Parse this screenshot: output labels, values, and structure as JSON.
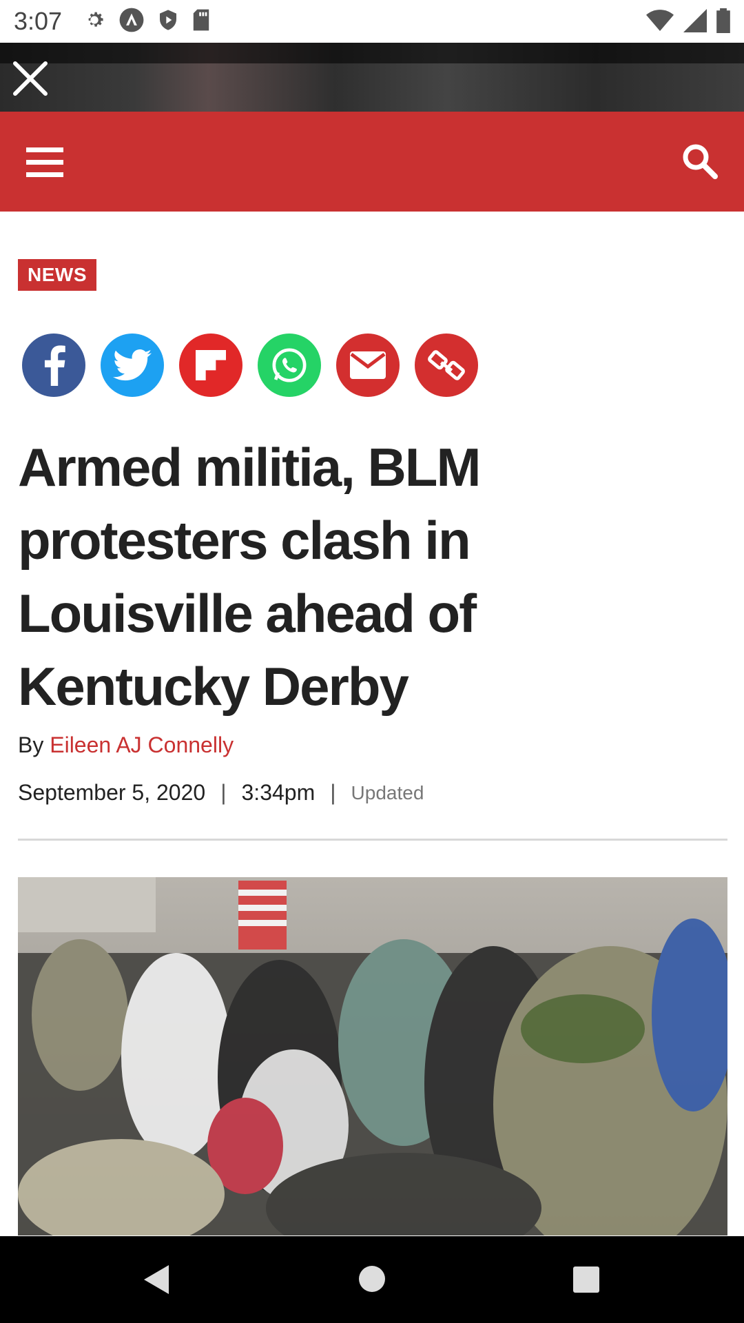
{
  "status_bar": {
    "time": "3:07"
  },
  "header": {
    "menu_icon": "hamburger-menu-icon",
    "search_icon": "search-icon"
  },
  "banner": {
    "close_icon": "close-icon"
  },
  "article": {
    "category": "NEWS",
    "headline": "Armed militia, BLM protesters clash in Louisville ahead of Kentucky Derby",
    "byline_prefix": "By",
    "author": "Eileen AJ Connelly",
    "date": "September 5, 2020",
    "time": "3:34pm",
    "updated_label": "Updated",
    "separator": "|"
  },
  "share": [
    {
      "name": "facebook-share-icon",
      "color": "#3b5998"
    },
    {
      "name": "twitter-share-icon",
      "color": "#1da1f2"
    },
    {
      "name": "flipboard-share-icon",
      "color": "#e12828"
    },
    {
      "name": "whatsapp-share-icon",
      "color": "#25d366"
    },
    {
      "name": "email-share-icon",
      "color": "#d32f2f"
    },
    {
      "name": "copy-link-share-icon",
      "color": "#d32f2f"
    }
  ],
  "colors": {
    "brand_red": "#c93131",
    "text": "#222222"
  }
}
